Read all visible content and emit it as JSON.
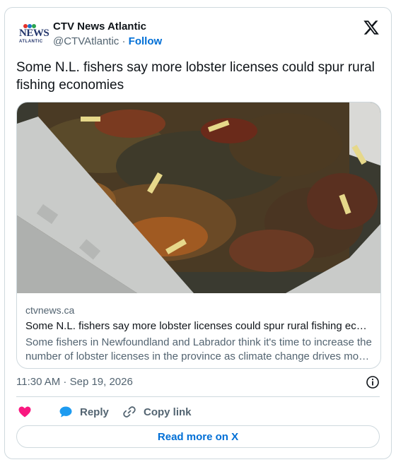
{
  "account": {
    "name": "CTV News Atlantic",
    "handle": "@CTVAtlantic",
    "separator": "·",
    "follow_label": "Follow",
    "logo_line1": "NEWS",
    "logo_line2": "ATLANTIC"
  },
  "tweet": {
    "text": "Some N.L. fishers say more lobster licenses could spur rural fishing economies",
    "timestamp": "11:30 AM · Sep 19, 2026"
  },
  "link_card": {
    "image_icon": "lobster-photo",
    "domain": "ctvnews.ca",
    "title": "Some N.L. fishers say more lobster licenses could spur rural fishing ec…",
    "description": "Some fishers in Newfoundland and Labrador think it's time to increase the number of lobster licenses in the province as climate change drives mo…"
  },
  "actions": {
    "like_icon": "heart-icon",
    "reply_label": "Reply",
    "copy_link_label": "Copy link",
    "read_more_label": "Read more on X"
  },
  "colors": {
    "accent": "#006fd6",
    "heart": "#f91880",
    "muted": "#536471",
    "border": "#cfd9de",
    "brand_navy": "#23356b"
  }
}
